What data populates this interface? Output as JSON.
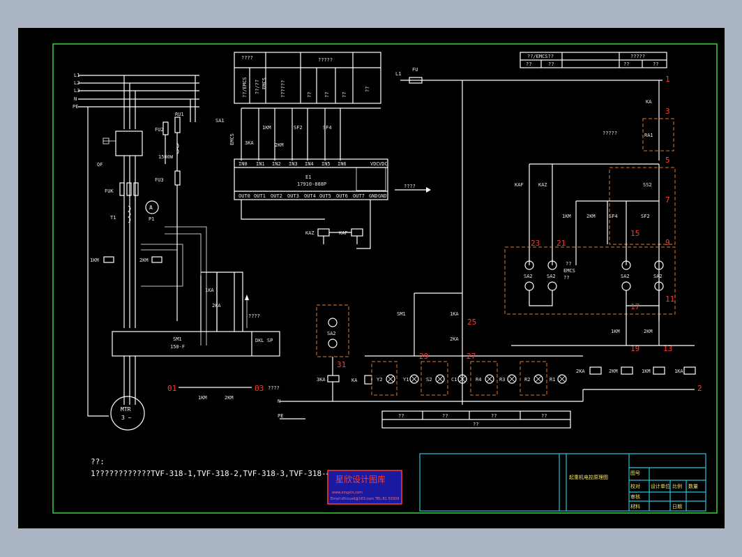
{
  "notes": {
    "heading": "??:",
    "line1": "1????????????TVF-318-1,TVF-318-2,TVF-318-3,TVF-318-4?"
  },
  "watermark": {
    "title": "星欣设计图库",
    "line1": "www.xingxin.com",
    "line2": "Email:dfcnusd@163.com  TEL:81 50309"
  },
  "title_block": {
    "drawing_name": "起重机电控原理图",
    "designer_label": "设计单位",
    "field_1": "图号",
    "field_2": "比例",
    "field_3": "数量",
    "field_4": "校对",
    "field_5": "审核",
    "field_6": "材料",
    "field_7": "日期"
  },
  "upper_table": {
    "header_left": "????",
    "header_right": "?????",
    "cols": [
      "??/EMCS",
      "??/??",
      "EMCS",
      "??????",
      "??",
      "??",
      "??",
      "??"
    ]
  },
  "right_table": {
    "header_1": "??/EMCS??",
    "header_2": "?????",
    "cells": [
      "??",
      "??",
      "??",
      "??"
    ]
  },
  "plc": {
    "name": "E1",
    "model": "17910-888P",
    "inputs": [
      "IN0",
      "IN1",
      "IN2",
      "IN3",
      "IN4",
      "IN5",
      "IN6",
      "VDC",
      "VDC"
    ],
    "outputs": [
      "OUT0",
      "OUT1",
      "OUT2",
      "OUT3",
      "OUT4",
      "OUT5",
      "OUT6",
      "OUT7",
      "GND",
      "GND"
    ],
    "arrow_label": "????"
  },
  "vfd": {
    "name": "SM1",
    "model": "150-F",
    "side_label": "DKL SP"
  },
  "motor": {
    "name": "MTR",
    "phases": "3 ~"
  },
  "supply": {
    "lines": [
      "L1",
      "L2",
      "L3",
      "N",
      "PE"
    ]
  },
  "labels": {
    "qf": "QF",
    "fuk": "FUK",
    "t1": "T1",
    "p1": "P1",
    "km1": "1KM",
    "km2": "2KM",
    "fu2": "FU2",
    "fu3": "FU3",
    "ru1": "RU1",
    "sa1": "SA1",
    "ka1": "1KA",
    "ka2": "2KA",
    "kaz": "KAZ",
    "kaf": "KAF",
    "fu": "FU",
    "ka": "KA",
    "ra1": "RA1",
    "ss2": "SS2",
    "sf4": "SF4",
    "sf2": "SF2",
    "sa2": "SA2",
    "ka3": "3KA",
    "sm1": "SM1",
    "emcs": "EMCS",
    "emcs_q": "??",
    "q5": "?????",
    "q6": "??????",
    "q4": "????",
    "pe": "PE",
    "n": "N",
    "v1500": "1500W"
  },
  "node_numbers": [
    "1",
    "3",
    "5",
    "7",
    "9",
    "11",
    "13",
    "15",
    "17",
    "19",
    "21",
    "23",
    "25",
    "27",
    "29",
    "31",
    "2",
    "01",
    "03"
  ],
  "lamps": [
    "Y2",
    "Y1",
    "S2",
    "C1",
    "R4",
    "R3",
    "R2",
    "R1"
  ],
  "coils": [
    "2KA",
    "2KM",
    "1KM",
    "1KA"
  ],
  "bottom_table": [
    "??",
    "??",
    "??",
    "??",
    "??"
  ],
  "colors": {
    "background": "#000000",
    "outer_frame": "#35d03a",
    "wiring": "#ffffff",
    "node_numbers": "#ff3b30",
    "dashed_boxes": "#e07a2a",
    "title_block": "#27c6d9",
    "watermark": "#1a1aa0"
  }
}
